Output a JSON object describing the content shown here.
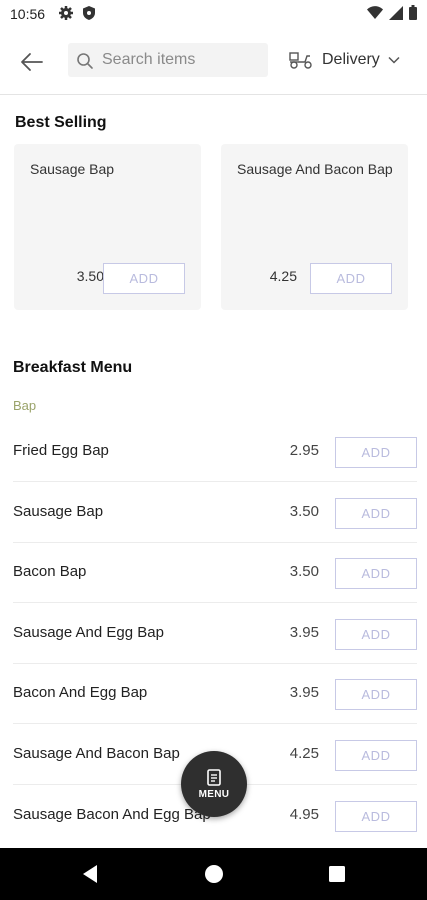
{
  "status": {
    "time": "10:56"
  },
  "header": {
    "search_placeholder": "Search items",
    "delivery_label": "Delivery"
  },
  "best_selling": {
    "title": "Best Selling",
    "items": [
      {
        "name": "Sausage Bap",
        "price": "3.50",
        "add": "ADD"
      },
      {
        "name": "Sausage And Bacon Bap",
        "price": "4.25",
        "add": "ADD"
      }
    ]
  },
  "menu": {
    "title": "Breakfast Menu",
    "category": "Bap",
    "items": [
      {
        "name": "Fried Egg Bap",
        "price": "2.95",
        "add": "ADD"
      },
      {
        "name": "Sausage Bap",
        "price": "3.50",
        "add": "ADD"
      },
      {
        "name": "Bacon Bap",
        "price": "3.50",
        "add": "ADD"
      },
      {
        "name": "Sausage And Egg Bap",
        "price": "3.95",
        "add": "ADD"
      },
      {
        "name": "Bacon And Egg Bap",
        "price": "3.95",
        "add": "ADD"
      },
      {
        "name": "Sausage And Bacon Bap",
        "price": "4.25",
        "add": "ADD"
      },
      {
        "name": "Sausage Bacon And Egg Bap",
        "price": "4.95",
        "add": "ADD"
      }
    ]
  },
  "fab": {
    "label": "MENU"
  }
}
